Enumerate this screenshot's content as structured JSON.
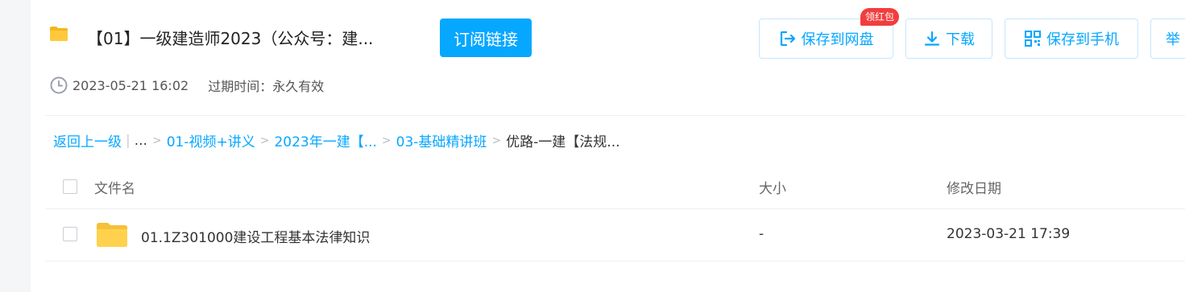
{
  "header": {
    "folder_icon": "folder-icon",
    "title": "【01】一级建造师2023（公众号：建...",
    "subscribe_label": "订阅链接",
    "actions": {
      "save_to_disk": "保存到网盘",
      "download": "下载",
      "save_to_phone": "保存到手机",
      "report": "举"
    },
    "badge": "领红包",
    "meta": {
      "created": "2023-05-21 16:02",
      "expire": "过期时间：永久有效"
    }
  },
  "breadcrumb": {
    "back": "返回上一级",
    "ellipsis": "...",
    "items": [
      "01-视频+讲义",
      "2023年一建【...",
      "03-基础精讲班"
    ],
    "current": "优路-一建【法规..."
  },
  "table": {
    "headers": {
      "name": "文件名",
      "size": "大小",
      "date": "修改日期"
    },
    "rows": [
      {
        "name": "01.1Z301000建设工程基本法律知识",
        "size": "-",
        "date": "2023-03-21 17:39",
        "icon": "folder-icon"
      }
    ]
  },
  "colors": {
    "accent": "#06a7ff",
    "badge": "#f23d3d",
    "folder": "#ffd24d"
  }
}
